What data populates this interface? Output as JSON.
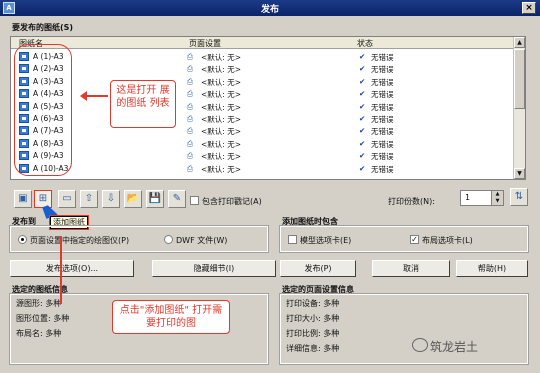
{
  "window": {
    "title": "发布",
    "icon_text": "A",
    "close_glyph": "×"
  },
  "sheets_section": {
    "label": "要发布的图纸(S)"
  },
  "columns": {
    "name": "图纸名",
    "page_setup": "页面设置",
    "status": "状态"
  },
  "rows": [
    {
      "name": "A (1)-A3",
      "page_setup": "<默认: 无>",
      "status": "无错误"
    },
    {
      "name": "A (2)-A3",
      "page_setup": "<默认: 无>",
      "status": "无错误"
    },
    {
      "name": "A (3)-A3",
      "page_setup": "<默认: 无>",
      "status": "无错误"
    },
    {
      "name": "A (4)-A3",
      "page_setup": "<默认: 无>",
      "status": "无错误"
    },
    {
      "name": "A (5)-A3",
      "page_setup": "<默认: 无>",
      "status": "无错误"
    },
    {
      "name": "A (6)-A3",
      "page_setup": "<默认: 无>",
      "status": "无错误"
    },
    {
      "name": "A (7)-A3",
      "page_setup": "<默认: 无>",
      "status": "无错误"
    },
    {
      "name": "A (8)-A3",
      "page_setup": "<默认: 无>",
      "status": "无错误"
    },
    {
      "name": "A (9)-A3",
      "page_setup": "<默认: 无>",
      "status": "无错误"
    },
    {
      "name": "A (10)-A3",
      "page_setup": "<默认: 无>",
      "status": "无错误"
    }
  ],
  "annotations": {
    "list_callout": "这是打开 展的图纸 列表",
    "add_callout": "点击\"添加图纸\" 打开需要打印的图",
    "tooltip": "添加图纸"
  },
  "toolbar": {
    "include_stamp": "包含打印戳记(A)",
    "copies_label": "打印份数(N):",
    "copies_value": "1"
  },
  "publish_to": {
    "label": "发布到",
    "option_plotter": "页面设置中指定的绘图仪(P)",
    "option_dwf": "DWF 文件(W)"
  },
  "add_sheets_group": {
    "label": "添加图纸时包含",
    "model_tab": "模型选项卡(E)",
    "layout_tab": "布局选项卡(L)"
  },
  "buttons": {
    "publish_options": "发布选项(O)...",
    "hide_details": "隐藏细节(I)",
    "publish": "发布(P)",
    "cancel": "取消",
    "help": "帮助(H)"
  },
  "selected_sheet_info": {
    "label": "选定的图纸信息",
    "source": "源图形: 多种",
    "location": "图形位置: 多种",
    "layout": "布局名: 多种"
  },
  "selected_page_setup_info": {
    "label": "选定的页面设置信息",
    "device": "打印设备: 多种",
    "size": "打印大小: 多种",
    "scale": "打印比例: 多种",
    "details": "详细信息: 多种"
  },
  "watermark": "筑龙岩土",
  "colors": {
    "annotation_red": "#e0392d",
    "titlebar_blue": "#0a246a",
    "check_blue": "#1a3ea8"
  }
}
